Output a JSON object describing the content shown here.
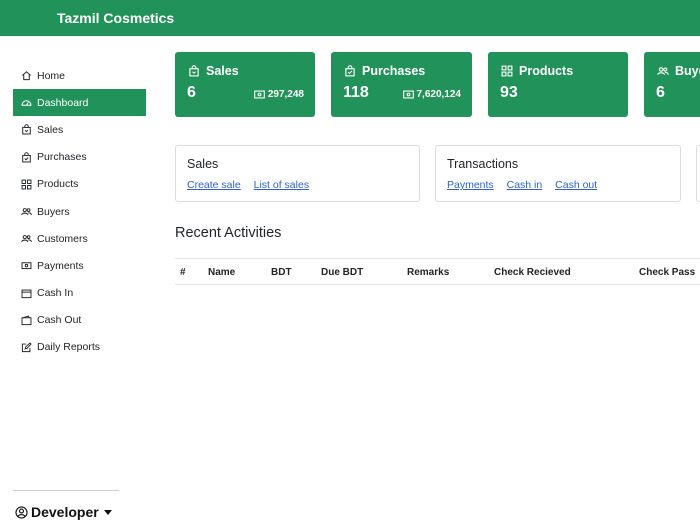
{
  "app": {
    "brand": "Tazmil Cosmetics"
  },
  "sidebar": {
    "items": [
      {
        "label": "Home",
        "icon": "home-icon"
      },
      {
        "label": "Dashboard",
        "icon": "dashboard-icon",
        "active": true
      },
      {
        "label": "Sales",
        "icon": "shopping-bag-icon"
      },
      {
        "label": "Purchases",
        "icon": "bag-check-icon"
      },
      {
        "label": "Products",
        "icon": "grid-icon"
      },
      {
        "label": "Buyers",
        "icon": "people-icon"
      },
      {
        "label": "Customers",
        "icon": "people-icon"
      },
      {
        "label": "Payments",
        "icon": "cash-icon"
      },
      {
        "label": "Cash In",
        "icon": "wallet-icon"
      },
      {
        "label": "Cash Out",
        "icon": "wallet-out-icon"
      },
      {
        "label": "Daily Reports",
        "icon": "pencil-square-icon"
      }
    ],
    "user": {
      "label": "Developer",
      "icon": "user-circle-icon"
    }
  },
  "stats": [
    {
      "title": "Sales",
      "count": "6",
      "amount": "297,248",
      "icon": "shopping-bag-icon"
    },
    {
      "title": "Purchases",
      "count": "118",
      "amount": "7,620,124",
      "icon": "bag-check-icon"
    },
    {
      "title": "Products",
      "count": "93",
      "amount": "",
      "icon": "grid-icon"
    },
    {
      "title": "Buyers",
      "count": "6",
      "amount": "",
      "icon": "people-icon"
    }
  ],
  "cards": [
    {
      "title": "Sales",
      "links": [
        "Create sale",
        "List of sales"
      ]
    },
    {
      "title": "Transactions",
      "links": [
        "Payments",
        "Cash in",
        "Cash out"
      ]
    }
  ],
  "recent": {
    "title": "Recent Activities",
    "columns": [
      "#",
      "Name",
      "BDT",
      "Due BDT",
      "Remarks",
      "Check Recieved",
      "Check Pass"
    ]
  },
  "colors": {
    "brand_green": "#21925a",
    "link_blue": "#2f62c7"
  }
}
